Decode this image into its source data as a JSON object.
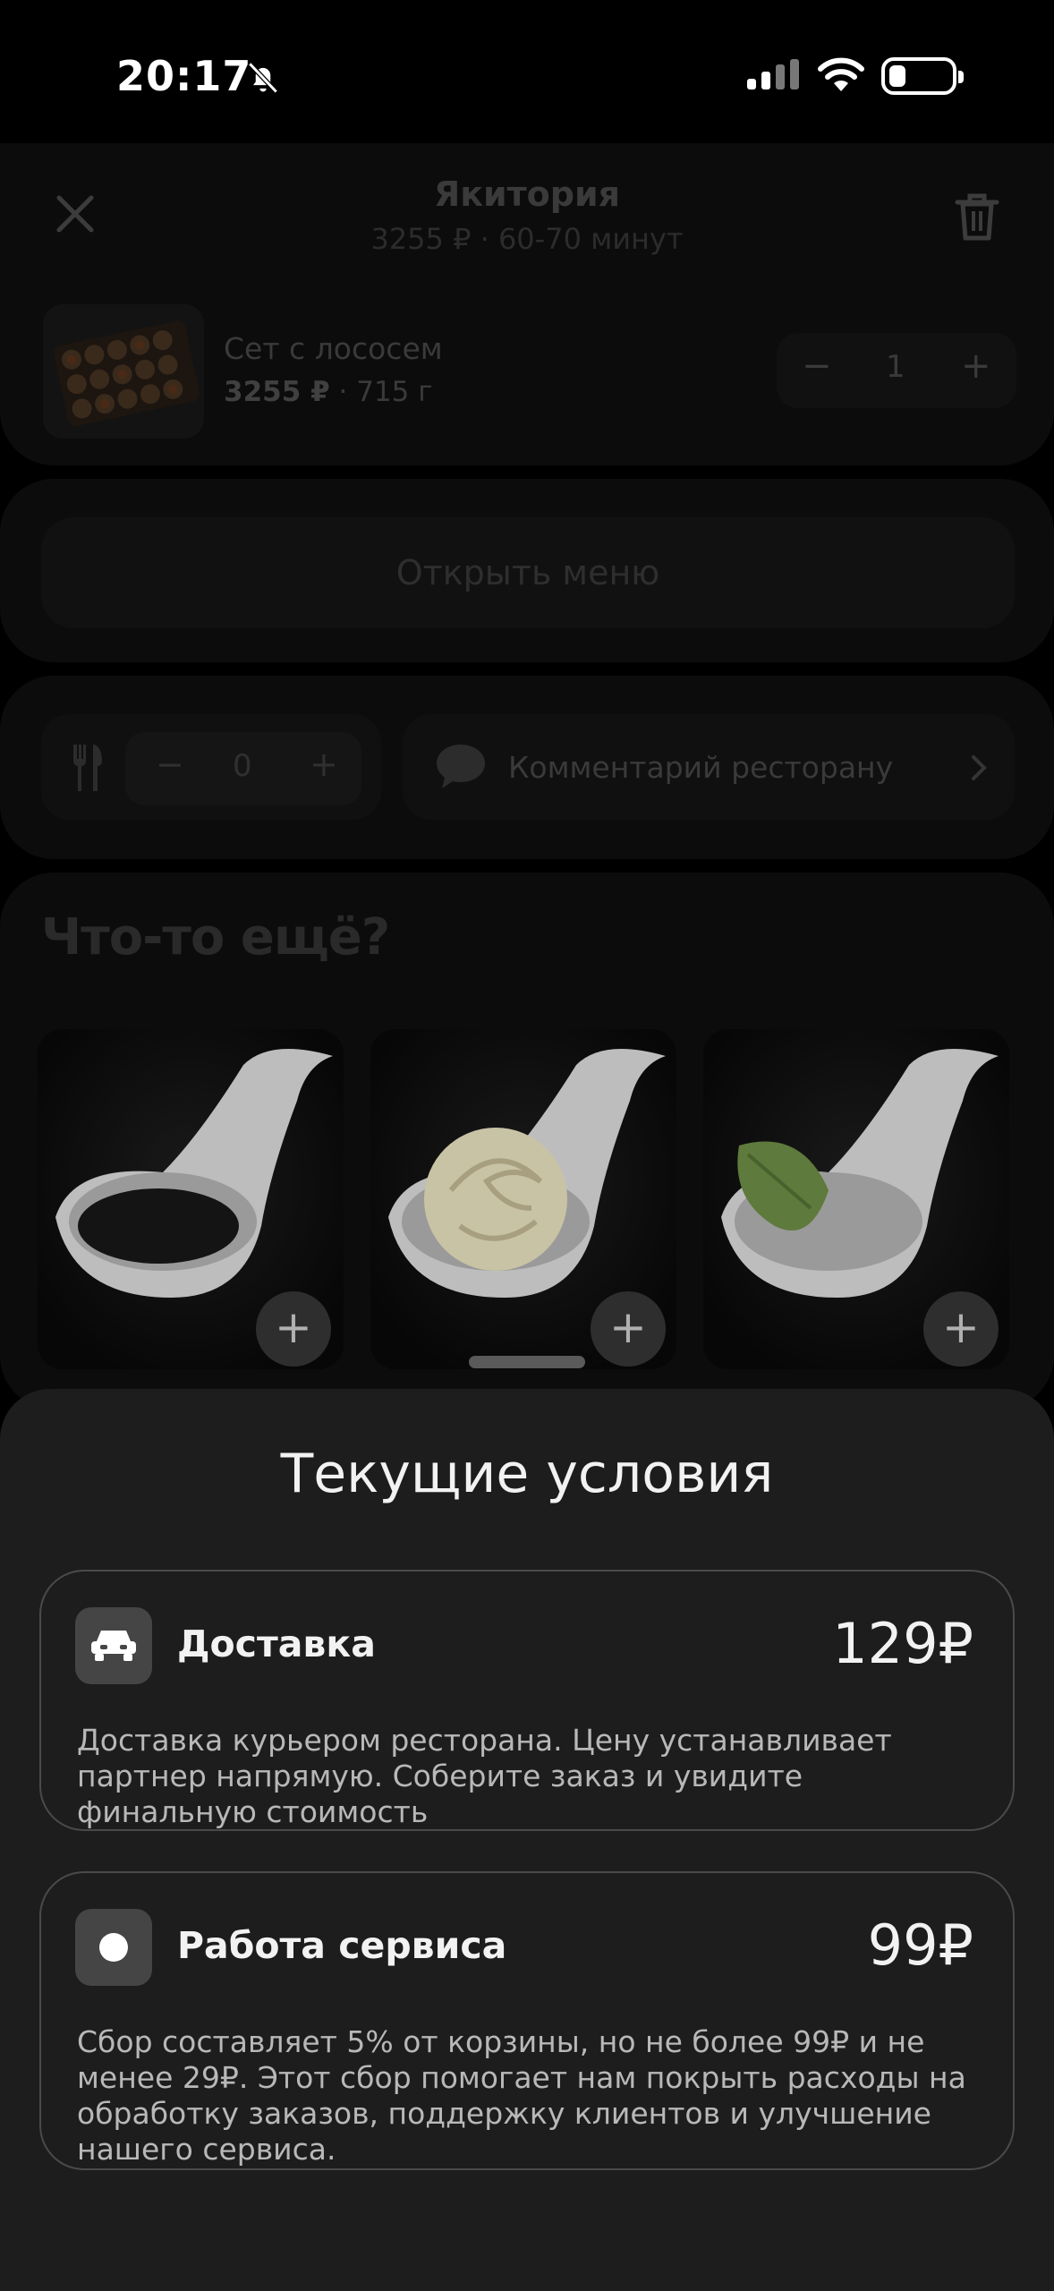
{
  "status_bar": {
    "time": "20:17"
  },
  "restaurant": {
    "name": "Якитория",
    "summary": "3255 ₽ · 60-70 минут"
  },
  "cart_item": {
    "name": "Сет с лососем",
    "price": "3255 ₽",
    "weight": "· 715 г",
    "quantity": "1",
    "minus": "−",
    "plus": "+"
  },
  "open_menu_label": "Открыть меню",
  "cutlery": {
    "count": "0",
    "minus": "−",
    "plus": "+"
  },
  "comment_label": "Комментарий ресторану",
  "upsell": {
    "title": "Что-то ещё?",
    "add_label": "+"
  },
  "sheet": {
    "title": "Текущие условия",
    "conditions": [
      {
        "name": "Доставка",
        "price": "129₽",
        "description": "Доставка курьером ресторана. Цену устанавливает партнер напрямую. Соберите заказ и увидите финальную стоимость",
        "icon": "car-icon"
      },
      {
        "name": "Работа сервиса",
        "price": "99₽",
        "description": "Сбор составляет 5% от корзины, но не более 99₽ и не менее 29₽. Этот сбор помогает нам покрыть расходы на обработку заказов, поддержку клиентов и улучшение нашего сервиса.",
        "icon": "dot-icon"
      }
    ]
  }
}
